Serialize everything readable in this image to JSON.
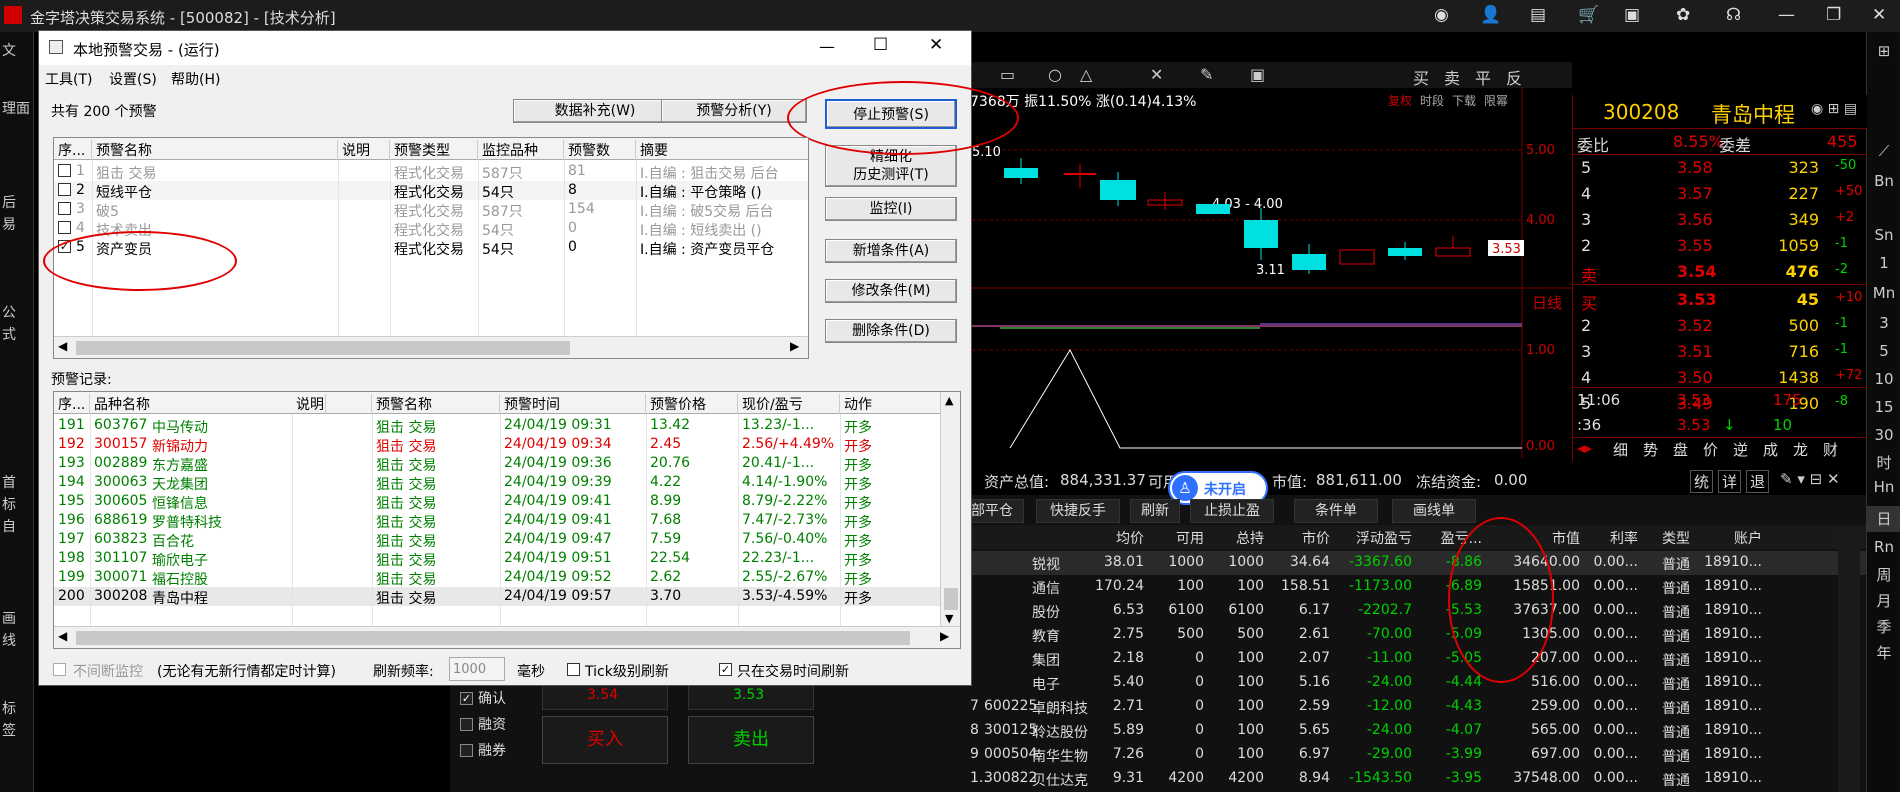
{
  "app": {
    "title": "金字塔决策交易系统 - [500082] - [技术分析]"
  },
  "left_nav": [
    "文",
    "理面",
    "后",
    "易",
    "公",
    "式",
    "首",
    "标",
    "自",
    "画",
    "线",
    "标",
    "签"
  ],
  "right_nav": [
    "Bn",
    "Sn",
    "1",
    "Mn",
    "3",
    "5",
    "10",
    "15",
    "30",
    "时",
    "Hn",
    "日",
    "Rn",
    "周",
    "月",
    "季",
    "年"
  ],
  "chart": {
    "info_text": "7368万 振11.50% 涨(0.14)4.13%",
    "labels": {
      "tr1": "复权",
      "tr2": "时段",
      "tr3": "下载",
      "tr4": "限幂"
    },
    "top_label": "5.10",
    "mid_label": "4.03 - 4.00",
    "low_label": "3.11",
    "price_tag": "3.53",
    "day_line": "日线",
    "axis": [
      "5.00",
      "4.00",
      "1.00",
      "0.00"
    ],
    "toolbar": [
      "买",
      "卖",
      "平",
      "反"
    ]
  },
  "quote": {
    "code": "300208",
    "name": "青岛中程",
    "weibi_label": "委比",
    "weibi": "8.55%",
    "weicha_label": "委差",
    "weicha": "455",
    "sell": [
      {
        "lvl": "5",
        "price": "3.58",
        "vol": "323",
        "chg": "-50"
      },
      {
        "lvl": "4",
        "price": "3.57",
        "vol": "227",
        "chg": "+50"
      },
      {
        "lvl": "3",
        "price": "3.56",
        "vol": "349",
        "chg": "+2"
      },
      {
        "lvl": "2",
        "price": "3.55",
        "vol": "1059",
        "chg": "-1"
      },
      {
        "lvl": "卖",
        "price": "3.54",
        "vol": "476",
        "chg": "-2"
      }
    ],
    "buy": [
      {
        "lvl": "买",
        "price": "3.53",
        "vol": "45",
        "chg": "+10"
      },
      {
        "lvl": "2",
        "price": "3.52",
        "vol": "500",
        "chg": "-1"
      },
      {
        "lvl": "3",
        "price": "3.51",
        "vol": "716",
        "chg": "-1"
      },
      {
        "lvl": "4",
        "price": "3.50",
        "vol": "1438",
        "chg": "+72"
      },
      {
        "lvl": "5",
        "price": "3.49",
        "vol": "190",
        "chg": "-8"
      }
    ],
    "ticks": [
      {
        "time": "11:06",
        "price": "3.53",
        "vol": "175"
      },
      {
        "time": ":36",
        "price": "3.53",
        "vol": "10"
      }
    ],
    "tabs": [
      "细",
      "势",
      "盘",
      "价",
      "逆",
      "成",
      "龙",
      "财"
    ]
  },
  "account": {
    "total_label": "资产总值:",
    "total": "884,331.37",
    "avail_label": "可用",
    "mv_label": "市值:",
    "mv": "881,611.00",
    "frozen_label": "冻结资金:",
    "frozen": "0.00",
    "badge": "未开启",
    "side_btns": [
      "统",
      "详",
      "退"
    ]
  },
  "pos_tabs": [
    "部平仓",
    "快捷反手",
    "刷新",
    "止损止盈",
    "条件单",
    "画线单"
  ],
  "pos_headers": [
    "均价",
    "可用",
    "总持",
    "市价",
    "浮动盈亏",
    "盈亏...",
    "市值",
    "利率",
    "类型",
    "账户"
  ],
  "positions": [
    {
      "no": "",
      "code": "",
      "name": "锐视",
      "avg": "38.01",
      "avail": "1000",
      "hold": "1000",
      "price": "34.64",
      "pl": "-3367.60",
      "plp": "-8.86",
      "mv": "34640.00",
      "rate": "0.00...",
      "type": "普通",
      "acct": "18910..."
    },
    {
      "no": "",
      "code": "",
      "name": "通信",
      "avg": "170.24",
      "avail": "100",
      "hold": "100",
      "price": "158.51",
      "pl": "-1173.00",
      "plp": "-6.89",
      "mv": "15851.00",
      "rate": "0.00...",
      "type": "普通",
      "acct": "18910..."
    },
    {
      "no": "",
      "code": "",
      "name": "股份",
      "avg": "6.53",
      "avail": "6100",
      "hold": "6100",
      "price": "6.17",
      "pl": "-2202.7",
      "plp": "-5.53",
      "mv": "37637.00",
      "rate": "0.00...",
      "type": "普通",
      "acct": "18910..."
    },
    {
      "no": "",
      "code": "",
      "name": "教育",
      "avg": "2.75",
      "avail": "500",
      "hold": "500",
      "price": "2.61",
      "pl": "-70.00",
      "plp": "-5.09",
      "mv": "1305.00",
      "rate": "0.00...",
      "type": "普通",
      "acct": "18910..."
    },
    {
      "no": "",
      "code": "",
      "name": "集团",
      "avg": "2.18",
      "avail": "0",
      "hold": "100",
      "price": "2.07",
      "pl": "-11.00",
      "plp": "-5.05",
      "mv": "207.00",
      "rate": "0.00...",
      "type": "普通",
      "acct": "18910..."
    },
    {
      "no": "",
      "code": "",
      "name": "电子",
      "avg": "5.40",
      "avail": "0",
      "hold": "100",
      "price": "5.16",
      "pl": "-24.00",
      "plp": "-4.44",
      "mv": "516.00",
      "rate": "0.00...",
      "type": "普通",
      "acct": "18910..."
    },
    {
      "no": "7",
      "code": "600225",
      "name": "卓朗科技",
      "avg": "2.71",
      "avail": "0",
      "hold": "100",
      "price": "2.59",
      "pl": "-12.00",
      "plp": "-4.43",
      "mv": "259.00",
      "rate": "0.00...",
      "type": "普通",
      "acct": "18910..."
    },
    {
      "no": "8",
      "code": "300125",
      "name": "聆达股份",
      "avg": "5.89",
      "avail": "0",
      "hold": "100",
      "price": "5.65",
      "pl": "-24.00",
      "plp": "-4.07",
      "mv": "565.00",
      "rate": "0.00...",
      "type": "普通",
      "acct": "18910..."
    },
    {
      "no": "9",
      "code": "000504",
      "name": "南华生物",
      "avg": "7.26",
      "avail": "0",
      "hold": "100",
      "price": "6.97",
      "pl": "-29.00",
      "plp": "-3.99",
      "mv": "697.00",
      "rate": "0.00...",
      "type": "普通",
      "acct": "18910..."
    },
    {
      "no": "1..",
      "code": "300822",
      "name": "贝仕达克",
      "avg": "9.31",
      "avail": "4200",
      "hold": "4200",
      "price": "8.94",
      "pl": "-1543.50",
      "plp": "-3.95",
      "mv": "37548.00",
      "rate": "0.00...",
      "type": "普通",
      "acct": "18910..."
    }
  ],
  "order": {
    "confirm": "确认",
    "margin": "融资",
    "short": "融券",
    "buy_price": "3.54",
    "sell_price": "3.53",
    "buy_btn": "买入",
    "sell_btn": "卖出"
  },
  "dialog": {
    "title": "本地预警交易 - (运行)",
    "menu": [
      "工具(T)",
      "设置(S)",
      "帮助(H)"
    ],
    "count_text": "共有 200 个预警",
    "btn_fill": "数据补充(W)",
    "btn_analysis": "预警分析(Y)",
    "btn_stop": "停止预警(S)",
    "btn_refine_1": "精细化",
    "btn_refine_2": "历史测评(T)",
    "btn_monitor": "监控(I)",
    "btn_add": "新增条件(A)",
    "btn_modify": "修改条件(M)",
    "btn_delete": "删除条件(D)",
    "alert_headers": [
      "序...",
      "预警名称",
      "说明",
      "预警类型",
      "监控品种",
      "预警数",
      "摘要"
    ],
    "alerts": [
      {
        "no": "1",
        "name": "狙击 交易",
        "type": "程式化交易",
        "var": "587只",
        "cnt": "81",
        "sum": "I.自编 : 狙击交易 后台",
        "checked": false,
        "active": false
      },
      {
        "no": "2",
        "name": "短线平仓",
        "type": "程式化交易",
        "var": "54只",
        "cnt": "8",
        "sum": "I.自编 : 平仓策略 ()",
        "checked": false,
        "active": true
      },
      {
        "no": "3",
        "name": "破5",
        "type": "程式化交易",
        "var": "587只",
        "cnt": "154",
        "sum": "I.自编 : 破5交易 后台",
        "checked": false,
        "active": false
      },
      {
        "no": "4",
        "name": "技术卖出",
        "type": "程式化交易",
        "var": "54只",
        "cnt": "0",
        "sum": "I.自编 : 短线卖出 ()",
        "checked": false,
        "active": false
      },
      {
        "no": "5",
        "name": "资产变员",
        "type": "程式化交易",
        "var": "54只",
        "cnt": "0",
        "sum": "I.自编 : 资产变员平仓",
        "checked": true,
        "active": true
      }
    ],
    "records_label": "预警记录:",
    "record_headers": [
      "序...",
      "品种名称",
      "说明",
      "预警名称",
      "预警时间",
      "预警价格",
      "现价/盈亏",
      "动作"
    ],
    "records": [
      {
        "no": "191",
        "code": "603767",
        "name": "中马传动",
        "alert": "狙击 交易",
        "time": "24/04/19 09:31",
        "price": "13.42",
        "cur": "13.23/-1...",
        "act": "开多",
        "color": "green"
      },
      {
        "no": "192",
        "code": "300157",
        "name": "新锦动力",
        "alert": "狙击 交易",
        "time": "24/04/19 09:34",
        "price": "2.45",
        "cur": "2.56/+4.49%",
        "act": "开多",
        "color": "red"
      },
      {
        "no": "193",
        "code": "002889",
        "name": "东方嘉盛",
        "alert": "狙击 交易",
        "time": "24/04/19 09:36",
        "price": "20.76",
        "cur": "20.41/-1...",
        "act": "开多",
        "color": "green"
      },
      {
        "no": "194",
        "code": "300063",
        "name": "天龙集团",
        "alert": "狙击 交易",
        "time": "24/04/19 09:39",
        "price": "4.22",
        "cur": "4.14/-1.90%",
        "act": "开多",
        "color": "green"
      },
      {
        "no": "195",
        "code": "300605",
        "name": "恒锋信息",
        "alert": "狙击 交易",
        "time": "24/04/19 09:41",
        "price": "8.99",
        "cur": "8.79/-2.22%",
        "act": "开多",
        "color": "green"
      },
      {
        "no": "196",
        "code": "688619",
        "name": "罗普特科技",
        "alert": "狙击 交易",
        "time": "24/04/19 09:41",
        "price": "7.68",
        "cur": "7.47/-2.73%",
        "act": "开多",
        "color": "green"
      },
      {
        "no": "197",
        "code": "603823",
        "name": "百合花",
        "alert": "狙击 交易",
        "time": "24/04/19 09:47",
        "price": "7.59",
        "cur": "7.56/-0.40%",
        "act": "开多",
        "color": "green"
      },
      {
        "no": "198",
        "code": "301107",
        "name": "瑜欣电子",
        "alert": "狙击 交易",
        "time": "24/04/19 09:51",
        "price": "22.54",
        "cur": "22.23/-1...",
        "act": "开多",
        "color": "green"
      },
      {
        "no": "199",
        "code": "300071",
        "name": "福石控股",
        "alert": "狙击 交易",
        "time": "24/04/19 09:52",
        "price": "2.62",
        "cur": "2.55/-2.67%",
        "act": "开多",
        "color": "green"
      },
      {
        "no": "200",
        "code": "300208",
        "name": "青岛中程",
        "alert": "狙击 交易",
        "time": "24/04/19 09:57",
        "price": "3.70",
        "cur": "3.53/-4.59%",
        "act": "开多",
        "color": "black"
      }
    ],
    "footer_monitor": "不间断监控",
    "footer_note": "(无论有无新行情都定时计算)",
    "refresh_label": "刷新频率:",
    "refresh_value": "1000",
    "refresh_unit": "毫秒",
    "tick_refresh": "Tick级别刷新",
    "only_trade": "只在交易时间刷新"
  }
}
